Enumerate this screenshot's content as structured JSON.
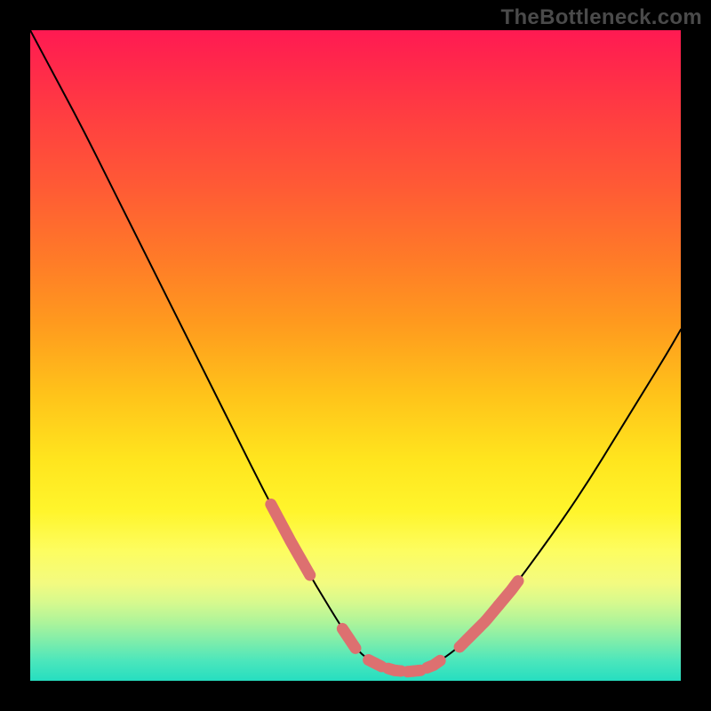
{
  "watermark": "TheBottleneck.com",
  "colors": {
    "curve": "#000000",
    "marker": "#dd7070",
    "background": "#000000"
  },
  "chart_data": {
    "type": "line",
    "title": "",
    "xlabel": "",
    "ylabel": "",
    "xlim": [
      0,
      100
    ],
    "ylim": [
      0,
      100
    ],
    "curve": {
      "x": [
        0,
        4,
        8,
        12,
        16,
        20,
        24,
        28,
        32,
        36,
        40,
        44,
        48,
        50,
        52,
        54,
        56,
        58,
        60,
        62,
        66,
        70,
        74,
        78,
        82,
        86,
        90,
        94,
        98,
        100
      ],
      "y": [
        100,
        92.5,
        85,
        77,
        69,
        61,
        53,
        45,
        37,
        29,
        21.5,
        14.5,
        8,
        5,
        3.2,
        2.2,
        1.6,
        1.4,
        1.6,
        2.4,
        5.2,
        9.2,
        14.0,
        19.4,
        25.0,
        31.0,
        37.5,
        44.0,
        50.5,
        54.0
      ]
    },
    "markers": {
      "note": "salmon rounded-dash overlay segments on the curve",
      "segments_x": [
        [
          37,
          43
        ],
        [
          48,
          50
        ],
        [
          52,
          54
        ],
        [
          55,
          57
        ],
        [
          58,
          60
        ],
        [
          61,
          63
        ],
        [
          66,
          72
        ],
        [
          72,
          75
        ]
      ]
    }
  }
}
